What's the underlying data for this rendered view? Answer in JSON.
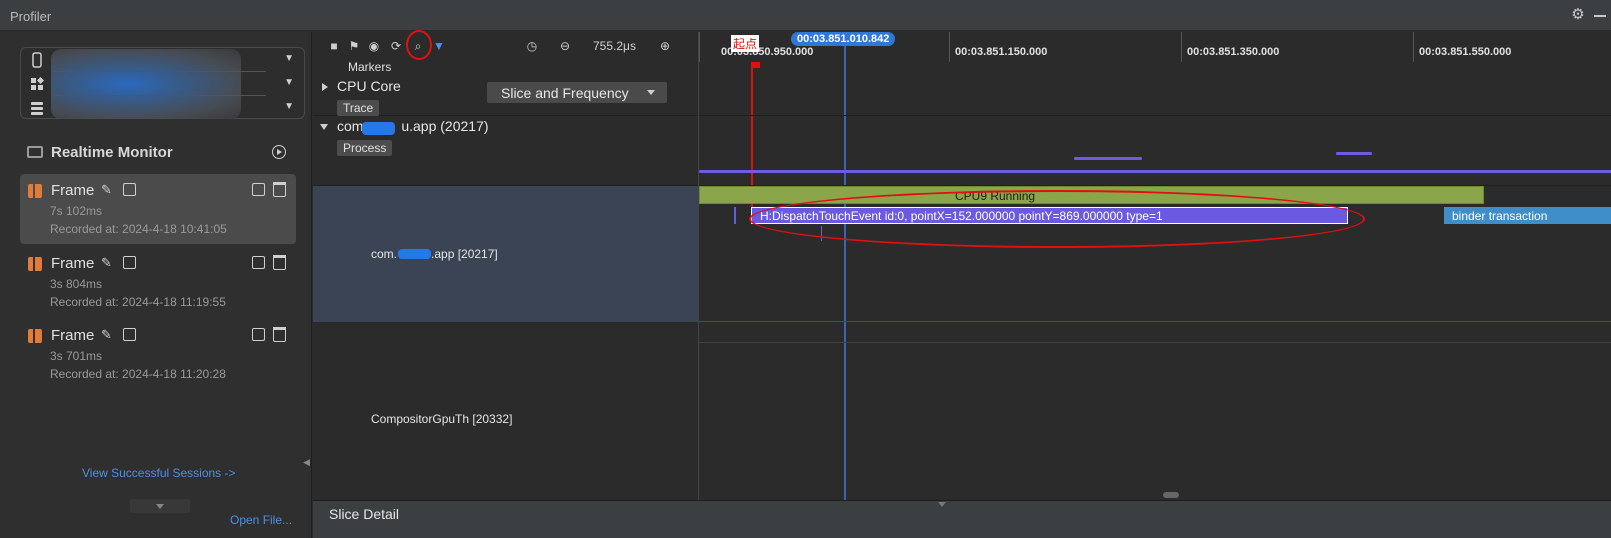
{
  "window": {
    "title": "Profiler"
  },
  "devices": {
    "rows": [
      "",
      "",
      ""
    ]
  },
  "realtime_monitor": {
    "label": "Realtime Monitor"
  },
  "sessions": [
    {
      "name": "Frame",
      "duration": "7s 102ms",
      "recorded": "Recorded at: 2024-4-18 10:41:05",
      "active": true
    },
    {
      "name": "Frame",
      "duration": "3s 804ms",
      "recorded": "Recorded at: 2024-4-18 11:19:55",
      "active": false
    },
    {
      "name": "Frame",
      "duration": "3s 701ms",
      "recorded": "Recorded at: 2024-4-18 11:20:28",
      "active": false
    }
  ],
  "links": {
    "view_sessions": "View Successful Sessions ->",
    "open_file": "Open File..."
  },
  "toolbar": {
    "zoom": "755.2μs"
  },
  "timeline": {
    "cursor": "00:03.851.010.842",
    "ticks": [
      "00:03.850.950.000",
      "00:03.851.150.000",
      "00:03.851.350.000",
      "00:03.851.550.000"
    ],
    "marker_label": "起点"
  },
  "tracks": {
    "markers": "Markers",
    "cpu_core": {
      "title": "CPU Core",
      "tag": "Trace",
      "dropdown": "Slice and Frequency"
    },
    "process": {
      "title": "com.█████u.app (20217)",
      "title_prefix": "com.",
      "title_suffix": "u.app (20217)",
      "tag": "Process"
    },
    "thread1": {
      "prefix": "com.",
      "suffix": ".app [20217]"
    },
    "thread2": {
      "name": "CompositorGpuTh [20332]"
    }
  },
  "slices": {
    "cpu_running": "CPU9 Running",
    "dispatch": "H:DispatchTouchEvent id:0, pointX=152.000000 pointY=869.000000 type=1",
    "binder": "binder transaction"
  },
  "detail": {
    "title": "Slice Detail"
  },
  "colors": {
    "accent": "#2f78d9",
    "annotation": "#e01010",
    "slice_purple": "#6a5adf",
    "cpu_green": "#8ba64a",
    "binder_blue": "#3f8ec8"
  }
}
